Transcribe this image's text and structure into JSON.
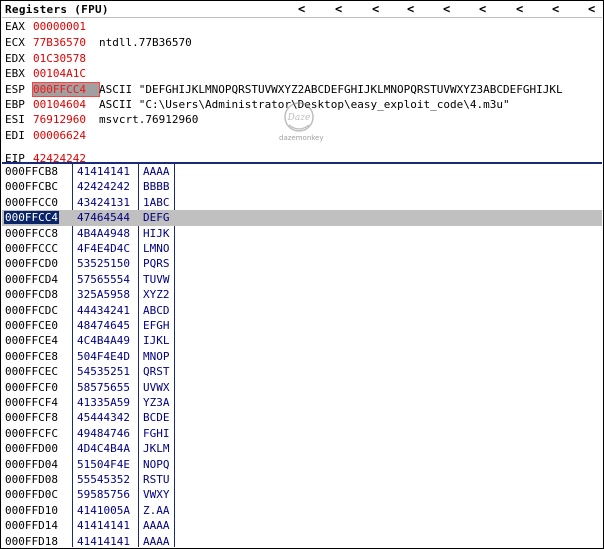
{
  "panel": {
    "title": "Registers (FPU)",
    "nav_glyph": "<"
  },
  "registers": [
    {
      "name": "EAX",
      "value": "00000001",
      "comment": ""
    },
    {
      "name": "ECX",
      "value": "77B36570",
      "comment": "ntdll.77B36570"
    },
    {
      "name": "EDX",
      "value": "01C30578",
      "comment": ""
    },
    {
      "name": "EBX",
      "value": "00104A1C",
      "comment": ""
    },
    {
      "name": "ESP",
      "value": "000FFCC4",
      "comment": "ASCII \"DEFGHIJKLMNOPQRSTUVWXYZ2ABCDEFGHIJKLMNOPQRSTUVWXYZ3ABCDEFGHIJKL"
    },
    {
      "name": "EBP",
      "value": "00104604",
      "comment": "ASCII \"C:\\Users\\Administrator\\Desktop\\easy_exploit_code\\4.m3u\""
    },
    {
      "name": "ESI",
      "value": "76912960",
      "comment": "msvcrt.76912960"
    },
    {
      "name": "EDI",
      "value": "00006624",
      "comment": ""
    },
    {
      "name": "EIP",
      "value": "42424242",
      "comment": ""
    }
  ],
  "watermark": {
    "text": "dazemonkey",
    "mark": "Daze"
  },
  "stack": [
    {
      "addr": "000FFCB8",
      "value": "41414141",
      "ascii": "AAAA"
    },
    {
      "addr": "000FFCBC",
      "value": "42424242",
      "ascii": "BBBB"
    },
    {
      "addr": "000FFCC0",
      "value": "43424131",
      "ascii": "1ABC"
    },
    {
      "addr": "000FFCC4",
      "value": "47464544",
      "ascii": "DEFG",
      "selected": true
    },
    {
      "addr": "000FFCC8",
      "value": "4B4A4948",
      "ascii": "HIJK"
    },
    {
      "addr": "000FFCCC",
      "value": "4F4E4D4C",
      "ascii": "LMNO"
    },
    {
      "addr": "000FFCD0",
      "value": "53525150",
      "ascii": "PQRS"
    },
    {
      "addr": "000FFCD4",
      "value": "57565554",
      "ascii": "TUVW"
    },
    {
      "addr": "000FFCD8",
      "value": "325A5958",
      "ascii": "XYZ2"
    },
    {
      "addr": "000FFCDC",
      "value": "44434241",
      "ascii": "ABCD"
    },
    {
      "addr": "000FFCE0",
      "value": "48474645",
      "ascii": "EFGH"
    },
    {
      "addr": "000FFCE4",
      "value": "4C4B4A49",
      "ascii": "IJKL"
    },
    {
      "addr": "000FFCE8",
      "value": "504F4E4D",
      "ascii": "MNOP"
    },
    {
      "addr": "000FFCEC",
      "value": "54535251",
      "ascii": "QRST"
    },
    {
      "addr": "000FFCF0",
      "value": "58575655",
      "ascii": "UVWX"
    },
    {
      "addr": "000FFCF4",
      "value": "41335A59",
      "ascii": "YZ3A"
    },
    {
      "addr": "000FFCF8",
      "value": "45444342",
      "ascii": "BCDE"
    },
    {
      "addr": "000FFCFC",
      "value": "49484746",
      "ascii": "FGHI"
    },
    {
      "addr": "000FFD00",
      "value": "4D4C4B4A",
      "ascii": "JKLM"
    },
    {
      "addr": "000FFD04",
      "value": "51504F4E",
      "ascii": "NOPQ"
    },
    {
      "addr": "000FFD08",
      "value": "55545352",
      "ascii": "RSTU"
    },
    {
      "addr": "000FFD0C",
      "value": "59585756",
      "ascii": "VWXY"
    },
    {
      "addr": "000FFD10",
      "value": "4141005A",
      "ascii": "Z.AA"
    },
    {
      "addr": "000FFD14",
      "value": "41414141",
      "ascii": "AAAA"
    },
    {
      "addr": "000FFD18",
      "value": "41414141",
      "ascii": "AAAA"
    }
  ]
}
